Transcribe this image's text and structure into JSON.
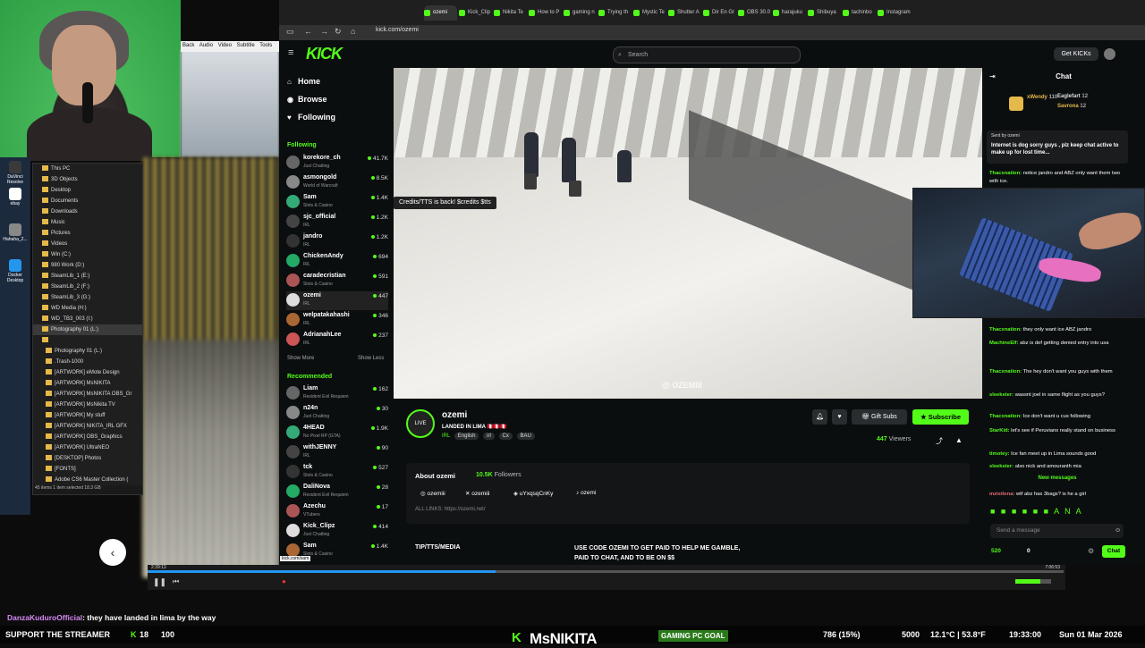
{
  "browser": {
    "tabs": [
      "ozemi",
      "Kick_Clip",
      "Nikita Te",
      "How to P",
      "gaming n",
      "Trying th",
      "Mystic Te",
      "Shutter A",
      "Dir En Gr",
      "OBS 30.0",
      "harajuku",
      "Shibuya",
      "tachinbo",
      "Instagram"
    ],
    "url": "kick.com/ozemi"
  },
  "kick": {
    "logo": "KICK",
    "search_placeholder": "Search",
    "get_kicks": "Get KICKs",
    "nav": [
      {
        "icon": "home-icon",
        "label": "Home",
        "glyph": "⌂"
      },
      {
        "icon": "compass-icon",
        "label": "Browse",
        "glyph": "◉"
      },
      {
        "icon": "heart-icon",
        "label": "Following",
        "glyph": "♥"
      }
    ],
    "following_header": "Following",
    "following": [
      {
        "name": "korekore_ch",
        "cat": "Just Chatting",
        "viewers": "41.7K"
      },
      {
        "name": "asmongold",
        "cat": "World of Warcraft",
        "viewers": "8.5K"
      },
      {
        "name": "Sam",
        "cat": "Slots & Casino",
        "viewers": "1.4K"
      },
      {
        "name": "sjc_official",
        "cat": "IRL",
        "viewers": "1.2K"
      },
      {
        "name": "jandro",
        "cat": "IRL",
        "viewers": "1.2K"
      },
      {
        "name": "ChickenAndy",
        "cat": "IRL",
        "viewers": "694"
      },
      {
        "name": "caradecristian",
        "cat": "Slots & Casino",
        "viewers": "591"
      },
      {
        "name": "ozemi",
        "cat": "IRL",
        "viewers": "447"
      },
      {
        "name": "welpatakahashi",
        "cat": "IRL",
        "viewers": "346"
      },
      {
        "name": "AdrianahLee",
        "cat": "IRL",
        "viewers": "237"
      }
    ],
    "show_more": "Show More",
    "show_less": "Show Less",
    "recommended_header": "Recommended",
    "recommended": [
      {
        "name": "Liam",
        "cat": "Resident Evil Requiem",
        "viewers": "162"
      },
      {
        "name": "n24n",
        "cat": "Just Chatting",
        "viewers": "30"
      },
      {
        "name": "4HEAD",
        "cat": "No Pixel RP (GTA)",
        "viewers": "1.9K"
      },
      {
        "name": "withJENNY",
        "cat": "IRL",
        "viewers": "90"
      },
      {
        "name": "tck",
        "cat": "Slots & Casino",
        "viewers": "527"
      },
      {
        "name": "DaliNova",
        "cat": "Resident Evil Requiem",
        "viewers": "28"
      },
      {
        "name": "Azechu",
        "cat": "VTubers",
        "viewers": "17"
      },
      {
        "name": "Kick_Clipz",
        "cat": "Just Chatting",
        "viewers": "414"
      },
      {
        "name": "Sam",
        "cat": "Slots & Casino",
        "viewers": "1.4K"
      }
    ],
    "video": {
      "tts_badge": "Credits/TTS is back! $credits $tts",
      "watermark": "@ OZEMIII"
    },
    "stream": {
      "name": "ozemi",
      "title": "LANDED IN LIMA 🇵🇪🇵🇪🇵🇪",
      "category": "IRL",
      "tags": [
        "English",
        "irl",
        "Cx",
        "BAU"
      ],
      "gift_subs": "Gift Subs",
      "subscribe": "Subscribe",
      "viewers": "447",
      "viewers_label": "Viewers",
      "about_label": "About ozemi",
      "followers": "10.5K",
      "followers_label": "Followers",
      "socials": [
        "ozemiii",
        "ozemiii",
        "uYxqsqCnKy",
        "ozemi"
      ],
      "all_links": "ALL LINKS: https://ozemi.net/",
      "tip_title": "TIP/TTS/MEDIA",
      "promo": "USE CODE OZEMI TO GET PAID TO HELP ME GAMBLE, PAID TO CHAT, AND TO BE ON $$"
    },
    "chat": {
      "title": "Chat",
      "gifters": [
        {
          "name": "xWendy",
          "count": "110",
          "color": "#e5b94a"
        },
        {
          "name": "Eaglefart",
          "count": "12",
          "color": "#fff"
        },
        {
          "name": "Savrona",
          "count": "12",
          "color": "#e5b94a"
        }
      ],
      "pinned_by": "Sent by ozemi",
      "pinned_msg": "Internet is dog sorry guys , plz keep chat active to make up for lost time...",
      "messages_top": [
        {
          "user": "Thacxnation:",
          "text": "notice jandro and ABZ only want them two with ice."
        }
      ],
      "messages": [
        {
          "user": "Thacxnation:",
          "text": "they only want ice ABZ jandro"
        },
        {
          "user": "MachineElf:",
          "text": "abz is def getting denied entry into usa"
        },
        {
          "user": "Thacxnation:",
          "text": "The hey don't want you guys with them"
        },
        {
          "user": "sleekster:",
          "text": "wassnt joel in same flight as you guys?"
        },
        {
          "user": "Thacxnation:",
          "text": "Ice don't want u cus following"
        },
        {
          "user": "StarKid:",
          "text": "let's see if Peruvians really stand on business"
        },
        {
          "user": "timotey:",
          "text": "Ice fan meet up in Lima sounds good"
        },
        {
          "user": "sleekster:",
          "text": "also nick and amouranth mia"
        }
      ],
      "new_messages": "New messages",
      "last_msg": {
        "user": "mzistlena:",
        "text": "wtf abz has 3bags? is he a girl"
      },
      "input_placeholder": "Send a message",
      "points": "520",
      "points2": "0",
      "send": "Chat"
    }
  },
  "explorer": {
    "items": [
      "This PC",
      "3D Objects",
      "Desktop",
      "Documents",
      "Downloads",
      "Music",
      "Pictures",
      "Videos",
      "Win (C:)",
      "980 Work (D:)",
      "SteamLib_1 (E:)",
      "SteamLib_2 (F:)",
      "SteamLib_3 (G:)",
      "WD Media (H:)",
      "WD_TB3_003 (I:)",
      "Photography 01 (L:)",
      "",
      "Photography 01 (L:)",
      ".Trash-1000",
      "[ARTWORK] eMote Design",
      "[ARTWORK] MsNIKITA",
      "[ARTWORK] MsNIKITA OBS_Gr",
      "[ARTWORK] MsNikita TV",
      "[ARTWORK] My stuff",
      "[ARTWORK] NIKITA_IRL GFX",
      "[ARTWORK] OBS_Graphics",
      "[ARTWORK] UltraNEO",
      "[DESKTOP] Photos",
      "[FONTS]",
      "Adobe CS6 Master Collection ("
    ],
    "status": "45 items   1 item selected  18.3 GB"
  },
  "desktop_icons": [
    "DaVinci Resolve",
    "ebay",
    "Hahaha_2...",
    "Docker Desktop"
  ],
  "player_menu": [
    "Back",
    "Audio",
    "Video",
    "Subtitle",
    "Tools"
  ],
  "player": {
    "t_start": "2:39:13",
    "t_end": "7:06:53",
    "progress": 0.38,
    "tooltip": "kick.com/sam"
  },
  "overlay": {
    "chat_line_user": "DanzaKuduroOfficial",
    "chat_line_text": ": they have landed in lima by the way",
    "ticker_left": "SUPPORT THE STREAMER",
    "ticker_k": "18",
    "ticker_count": "100",
    "brand": "MsNIKITA",
    "goal": "GAMING PC GOAL",
    "goal_value": "786 (15%)",
    "goal_target": "5000",
    "weather": "12.1°C | 53.8°F",
    "time": "19:33:00",
    "date": "Sun 01 Mar 2026"
  }
}
